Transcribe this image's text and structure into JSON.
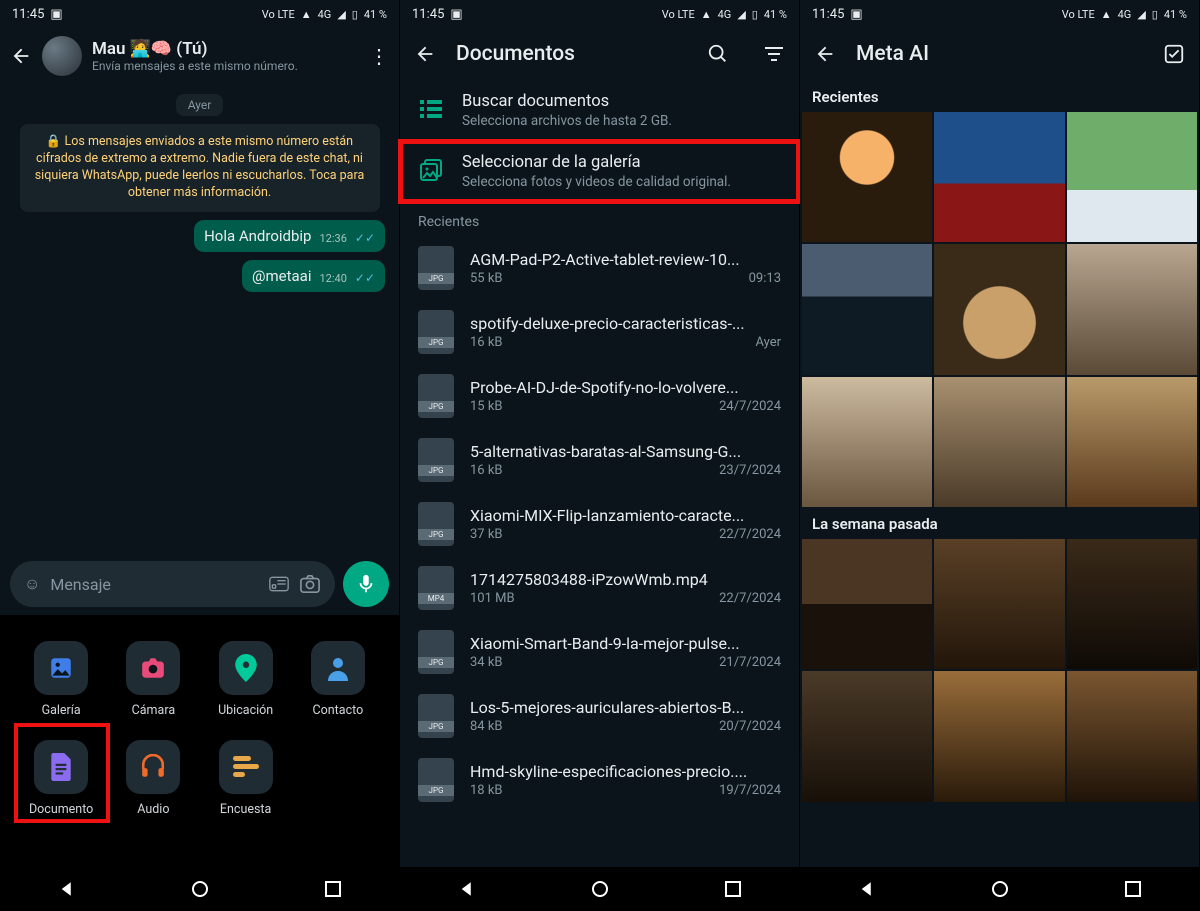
{
  "status": {
    "time": "11:45",
    "lte": "Vo LTE",
    "net": "4G",
    "battery": "41 %",
    "signal_icons": "▲◢"
  },
  "screen1": {
    "chat_name": "Mau 🧑‍💻🧠 (Tú)",
    "chat_sub": "Envía mensajes a este mismo número.",
    "day": "Ayer",
    "encryption": "🔒 Los mensajes enviados a este mismo número están cifrados de extremo a extremo. Nadie fuera de este chat, ni siquiera WhatsApp, puede leerlos ni escucharlos. Toca para obtener más información.",
    "msg1": {
      "text": "Hola Androidbip",
      "time": "12:36"
    },
    "msg2": {
      "text": "@metaai",
      "time": "12:40"
    },
    "input_placeholder": "Mensaje",
    "attach": {
      "gallery": "Galería",
      "camera": "Cámara",
      "location": "Ubicación",
      "contact": "Contacto",
      "document": "Documento",
      "audio": "Audio",
      "poll": "Encuesta"
    }
  },
  "screen2": {
    "title": "Documentos",
    "browse": {
      "title": "Buscar documentos",
      "sub": "Selecciona archivos de hasta 2 GB."
    },
    "gallery": {
      "title": "Seleccionar de la galería",
      "sub": "Selecciona fotos y videos de calidad original."
    },
    "recents_label": "Recientes",
    "files": [
      {
        "name": "AGM-Pad-P2-Active-tablet-review-10...",
        "size": "55 kB",
        "date": "09:13",
        "ext": "JPG"
      },
      {
        "name": "spotify-deluxe-precio-caracteristicas-...",
        "size": "16 kB",
        "date": "Ayer",
        "ext": "JPG"
      },
      {
        "name": "Probe-AI-DJ-de-Spotify-no-lo-volvere...",
        "size": "15 kB",
        "date": "24/7/2024",
        "ext": "JPG"
      },
      {
        "name": "5-alternativas-baratas-al-Samsung-G...",
        "size": "16 kB",
        "date": "23/7/2024",
        "ext": "JPG"
      },
      {
        "name": "Xiaomi-MIX-Flip-lanzamiento-caracte...",
        "size": "37 kB",
        "date": "22/7/2024",
        "ext": "JPG"
      },
      {
        "name": "1714275803488-iPzowWmb.mp4",
        "size": "101 MB",
        "date": "22/7/2024",
        "ext": "MP4"
      },
      {
        "name": "Xiaomi-Smart-Band-9-la-mejor-pulse...",
        "size": "34 kB",
        "date": "21/7/2024",
        "ext": "JPG"
      },
      {
        "name": "Los-5-mejores-auriculares-abiertos-B...",
        "size": "84 kB",
        "date": "20/7/2024",
        "ext": "JPG"
      },
      {
        "name": "Hmd-skyline-especificaciones-precio....",
        "size": "18 kB",
        "date": "19/7/2024",
        "ext": "JPG"
      }
    ]
  },
  "screen3": {
    "title": "Meta AI",
    "section_recent": "Recientes",
    "section_lastweek": "La semana pasada"
  }
}
